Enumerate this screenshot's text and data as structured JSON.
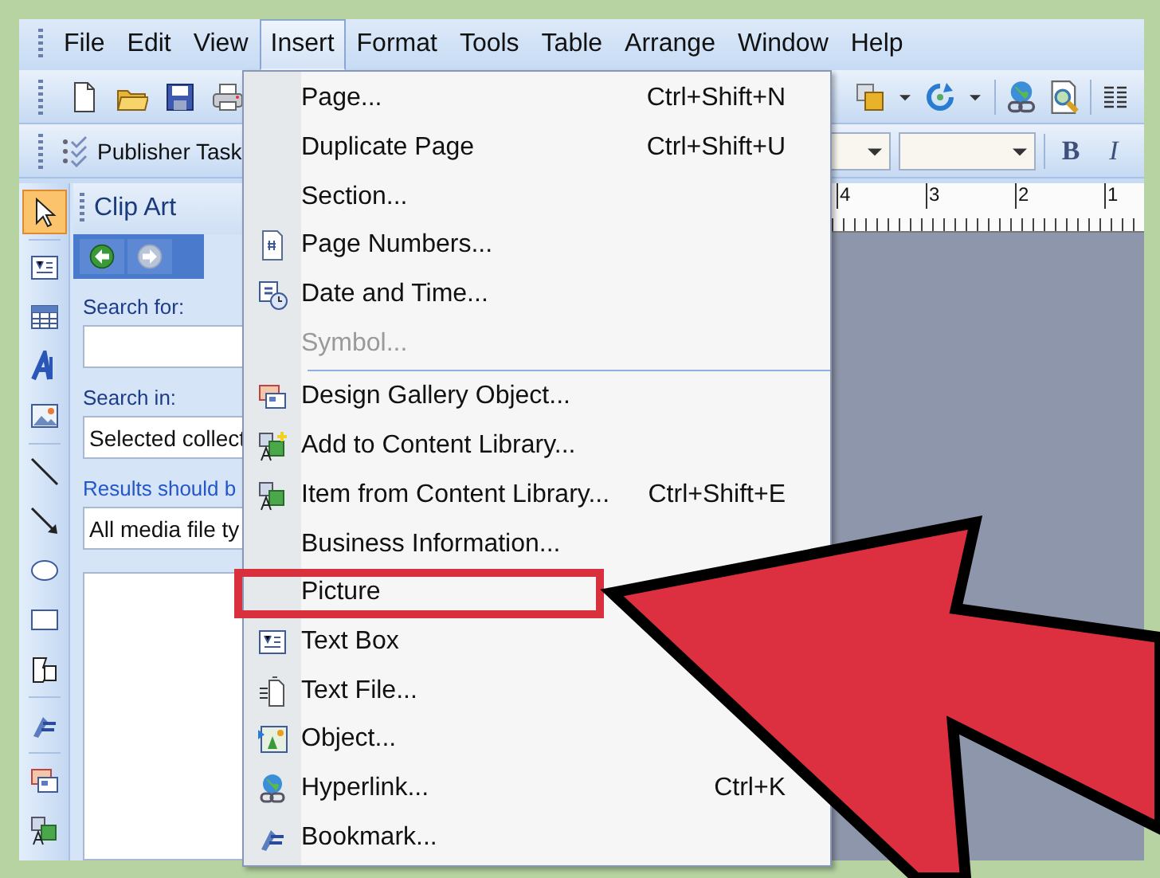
{
  "menu_bar": [
    {
      "label": "File",
      "selected": false
    },
    {
      "label": "Edit",
      "selected": false
    },
    {
      "label": "View",
      "selected": false
    },
    {
      "label": "Insert",
      "selected": true
    },
    {
      "label": "Format",
      "selected": false
    },
    {
      "label": "Tools",
      "selected": false
    },
    {
      "label": "Table",
      "selected": false
    },
    {
      "label": "Arrange",
      "selected": false
    },
    {
      "label": "Window",
      "selected": false
    },
    {
      "label": "Help",
      "selected": false
    }
  ],
  "formatting_toolbar": {
    "task_pane_button": "Publisher Task",
    "format_buttons": [
      "B",
      "I"
    ]
  },
  "tools": [
    {
      "selected": true
    },
    {
      "selected": false
    },
    {
      "selected": false
    },
    {
      "selected": false
    },
    {
      "selected": false
    },
    {
      "selected": false
    },
    {
      "selected": false
    },
    {
      "selected": false
    },
    {
      "selected": false
    },
    {
      "selected": false
    },
    {
      "selected": false
    },
    {
      "selected": false
    },
    {
      "selected": false
    }
  ],
  "task_pane": {
    "title": "Clip Art",
    "nav": [
      {
        "disabled": false
      },
      {
        "disabled": true
      }
    ],
    "search_label": "Search for:",
    "search_in_label": "Search in:",
    "search_in_value": "Selected collect",
    "results_label": "Results should b",
    "results_value": "All media file ty"
  },
  "ruler": [
    "4",
    "3",
    "2",
    "1"
  ],
  "insert_menu": {
    "items": [
      {
        "kind": "item",
        "label": "Page...",
        "shortcut": "Ctrl+Shift+N",
        "disabled": false,
        "highlighted": false
      },
      {
        "kind": "item",
        "label": "Duplicate Page",
        "shortcut": "Ctrl+Shift+U",
        "disabled": false,
        "highlighted": false
      },
      {
        "kind": "item",
        "label": "Section...",
        "disabled": false,
        "highlighted": false
      },
      {
        "kind": "item",
        "label": "Page Numbers...",
        "disabled": false,
        "highlighted": false
      },
      {
        "kind": "item",
        "label": "Date and Time...",
        "disabled": false,
        "highlighted": false
      },
      {
        "kind": "item",
        "label": "Symbol...",
        "disabled": true,
        "highlighted": false
      },
      {
        "kind": "separator"
      },
      {
        "kind": "item",
        "label": "Design Gallery Object...",
        "disabled": false,
        "highlighted": false
      },
      {
        "kind": "item",
        "label": "Add to Content Library...",
        "disabled": false,
        "highlighted": false
      },
      {
        "kind": "item",
        "label": "Item from Content Library...",
        "shortcut": "Ctrl+Shift+E",
        "disabled": false,
        "highlighted": false
      },
      {
        "kind": "item",
        "label": "Business Information...",
        "disabled": false,
        "highlighted": false
      },
      {
        "kind": "item",
        "label": "Picture",
        "disabled": false,
        "highlighted": true
      },
      {
        "kind": "item",
        "label": "Text Box",
        "disabled": false,
        "highlighted": false
      },
      {
        "kind": "item",
        "label": "Text File...",
        "disabled": false,
        "highlighted": false
      },
      {
        "kind": "item",
        "label": "Object...",
        "disabled": false,
        "highlighted": false
      },
      {
        "kind": "item",
        "label": "Hyperlink...",
        "shortcut": "Ctrl+K",
        "disabled": false,
        "highlighted": false
      },
      {
        "kind": "item",
        "label": "Bookmark...",
        "disabled": false,
        "highlighted": false
      }
    ]
  }
}
